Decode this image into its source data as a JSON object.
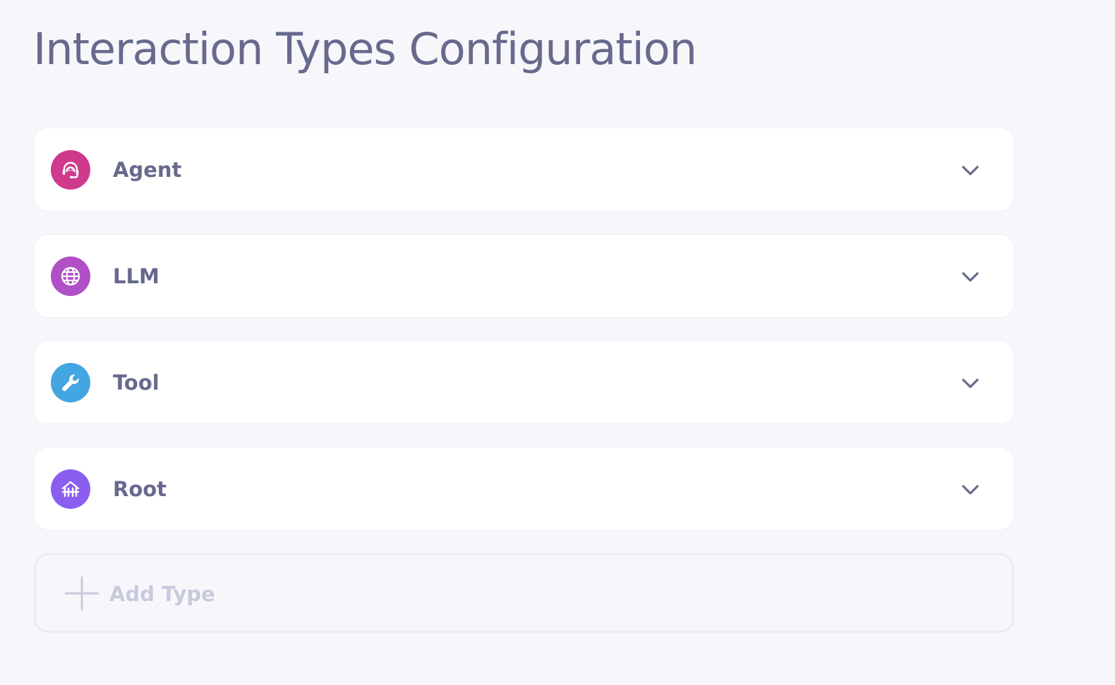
{
  "page": {
    "title": "Interaction Types Configuration"
  },
  "types": [
    {
      "label": "Agent",
      "icon": "headset-icon",
      "color": "#d03a8c"
    },
    {
      "label": "LLM",
      "icon": "globe-icon",
      "color": "#b14fc6"
    },
    {
      "label": "Tool",
      "icon": "wrench-icon",
      "color": "#44a5e3"
    },
    {
      "label": "Root",
      "icon": "home-network-icon",
      "color": "#8a5ef0"
    }
  ],
  "add_type": {
    "label": "Add Type",
    "icon": "plus-icon"
  },
  "colors": {
    "background": "#f7f7fb",
    "card": "#ffffff",
    "text": "#676a8d",
    "muted": "#c8c9db"
  }
}
